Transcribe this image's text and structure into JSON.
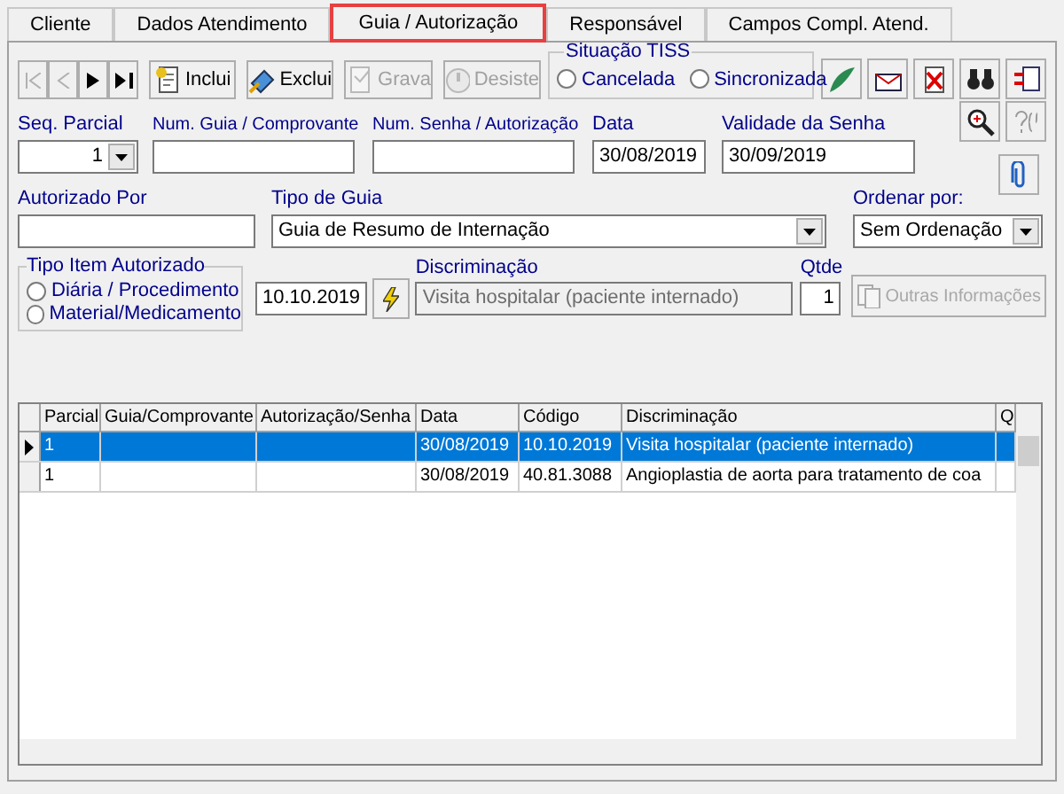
{
  "tabs": [
    {
      "label": "Cliente",
      "selected": false
    },
    {
      "label": "Dados Atendimento",
      "selected": false
    },
    {
      "label": "Guia / Autorização",
      "selected": true
    },
    {
      "label": "Responsável",
      "selected": false
    },
    {
      "label": "Campos Compl. Atend.",
      "selected": false
    }
  ],
  "nav_buttons": [
    {
      "kind": "first",
      "disabled": true
    },
    {
      "kind": "prev",
      "disabled": true
    },
    {
      "kind": "next",
      "disabled": false
    },
    {
      "kind": "last",
      "disabled": false
    }
  ],
  "action_buttons": [
    {
      "kind": "add",
      "label": "Inclui",
      "disabled": false
    },
    {
      "kind": "delete",
      "label": "Exclui",
      "disabled": false
    },
    {
      "kind": "save",
      "label": "Grava",
      "disabled": true
    },
    {
      "kind": "cancel",
      "label": "Desiste",
      "disabled": true
    }
  ],
  "situacao_tiss": {
    "title": "Situação TISS",
    "options": [
      {
        "label": "Cancelada",
        "selected": false
      },
      {
        "label": "Sincronizada",
        "selected": false
      }
    ]
  },
  "seq_parcial": {
    "label": "Seq. Parcial",
    "value": "1"
  },
  "num_guia": {
    "label": "Num. Guia / Comprovante"
  },
  "num_senha": {
    "label": "Num. Senha / Autorização"
  },
  "data": {
    "label": "Data",
    "value": "30/08/2019"
  },
  "validade_senha": {
    "label": "Validade da Senha",
    "value": "30/09/2019"
  },
  "autorizado_por": {
    "label": "Autorizado Por"
  },
  "tipo_guia": {
    "label": "Tipo de Guia",
    "value": "Guia de Resumo de Internação"
  },
  "ordenar_por": {
    "label": "Ordenar por:",
    "value": "Sem Ordenação"
  },
  "tipo_item": {
    "title": "Tipo Item Autorizado",
    "options": [
      {
        "label": "Diária / Procedimento",
        "selected": false
      },
      {
        "label": "Material/Medicamento",
        "selected": false
      }
    ]
  },
  "codigo": {
    "value": "10.10.2019"
  },
  "discriminacao": {
    "label": "Discriminação",
    "value": "Visita hospitalar (paciente internado)",
    "disabled": true
  },
  "qtde": {
    "label": "Qtde",
    "value": "1"
  },
  "outras_informacoes": {
    "label": "Outras Informações",
    "disabled": true
  },
  "table": {
    "columns": [
      "Parcial",
      "Guia/Comprovante",
      "Autorização/Senha",
      "Data",
      "Código",
      "Discriminação",
      "Q"
    ],
    "rows": [
      {
        "selected": true,
        "cells": [
          "1",
          "",
          "",
          "30/08/2019",
          "10.10.2019",
          "Visita hospitalar (paciente internado)",
          ""
        ]
      },
      {
        "selected": false,
        "cells": [
          "1",
          "",
          "",
          "30/08/2019",
          "40.81.3088",
          "Angioplastia de aorta para tratamento de coa",
          ""
        ]
      }
    ]
  }
}
